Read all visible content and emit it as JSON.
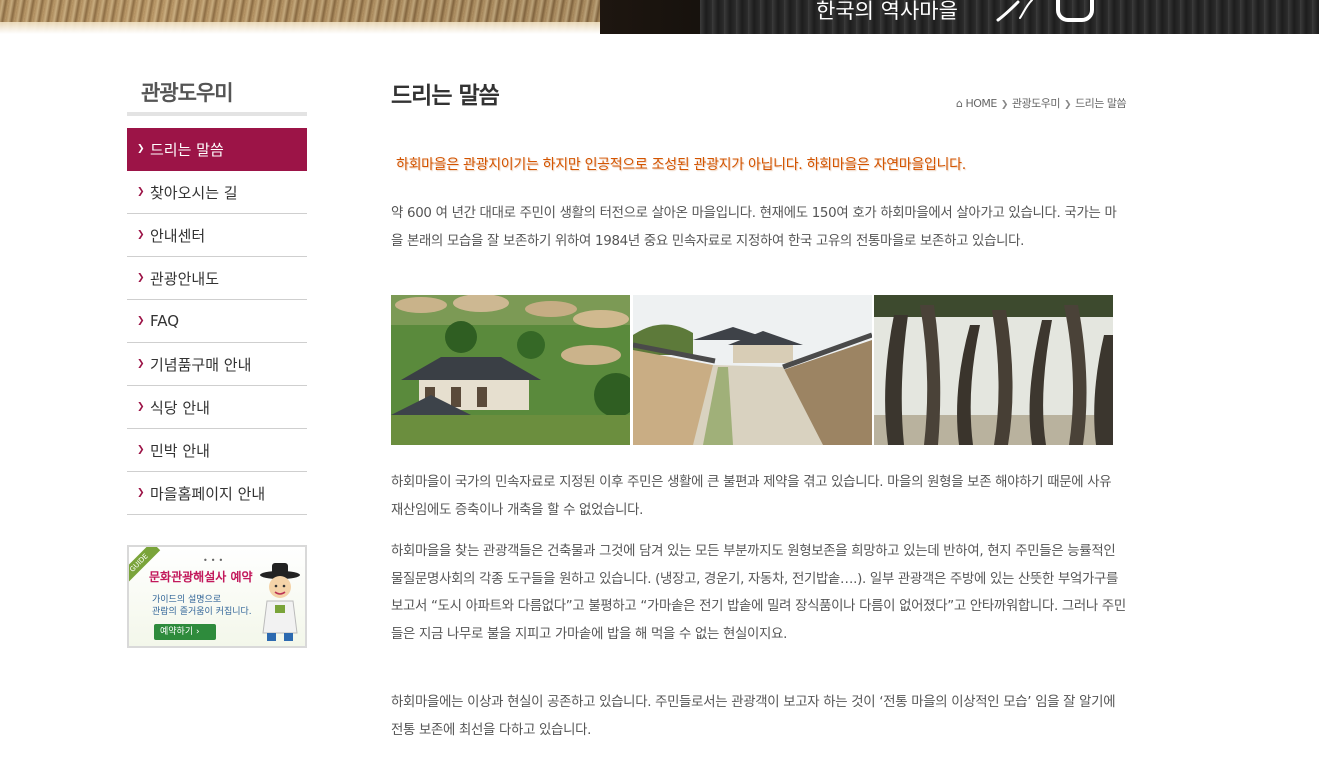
{
  "header": {
    "banner_title": "한국의 역사마을"
  },
  "sidebar": {
    "title": "관광도우미",
    "items": [
      {
        "label": "드리는 말씀",
        "active": true
      },
      {
        "label": "찾아오시는 길",
        "active": false
      },
      {
        "label": "안내센터",
        "active": false
      },
      {
        "label": "관광안내도",
        "active": false
      },
      {
        "label": "FAQ",
        "active": false
      },
      {
        "label": "기념품구매 안내",
        "active": false
      },
      {
        "label": "식당 안내",
        "active": false
      },
      {
        "label": "민박 안내",
        "active": false
      },
      {
        "label": "마을홈페이지 안내",
        "active": false
      }
    ],
    "guide_banner": {
      "ribbon": "GUIDE",
      "title": "문화관광해설사 예약",
      "line1": "가이드의 설명으로",
      "line2": "관람의 즐거움이 커집니다.",
      "button": "예약하기 ›"
    }
  },
  "main": {
    "title": "드리는 말씀",
    "breadcrumb": {
      "home": "HOME",
      "level1": "관광도우미",
      "level2": "드리는 말씀"
    },
    "slogan": "하회마을은 관광지이기는 하지만 인공적으로 조성된 관광지가 아닙니다. 하회마을은 자연마을입니다.",
    "paragraphs": [
      "약 600 여 년간 대대로 주민이 생활의 터전으로 살아온 마을입니다. 현재에도 150여 호가 하회마을에서 살아가고 있습니다. 국가는 마을 본래의 모습을 잘 보존하기 위하여 1984년 중요 민속자료로 지정하여 한국 고유의 전통마을로 보존하고 있습니다.",
      "하회마을이 국가의 민속자료로 지정된 이후 주민은 생활에 큰 불편과 제약을 겪고 있습니다. 마을의 원형을 보존 해야하기 때문에 사유 재산임에도 증축이나 개축을 할 수 없었습니다.",
      "하회마을을 찾는 관광객들은 건축물과 그것에 담겨 있는 모든 부분까지도 원형보존을 희망하고 있는데 반하여, 현지 주민들은 능률적인 물질문명사회의 각종 도구들을 원하고 있습니다. (냉장고, 경운기, 자동차, 전기밥솥….). 일부 관광객은 주방에 있는 산뜻한 부엌가구를 보고서 “도시 아파트와 다름없다”고 불평하고 “가마솥은 전기 밥솥에 밀려 장식품이나 다름이 없어졌다”고 안타까워합니다. 그러나 주민들은 지금 나무로 불을 지피고 가마솥에 밥을 해 먹을 수 없는 현실이지요.",
      "하회마을에는 이상과 현실이 공존하고 있습니다. 주민들로서는 관광객이 보고자 하는 것이 ‘전통 마을의 이상적인 모습’ 임을 잘 알기에 전통 보존에 최선을 다하고 있습니다."
    ]
  },
  "colors": {
    "accent": "#9c1447",
    "slogan": "#d35400"
  }
}
